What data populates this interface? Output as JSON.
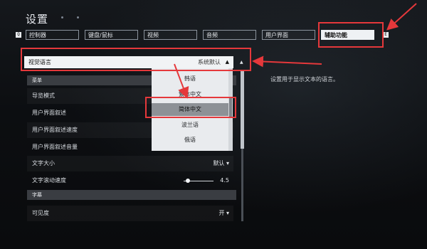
{
  "header": {
    "title": "设置"
  },
  "tabs": {
    "left_key": "Q",
    "right_key": "E",
    "items": [
      {
        "label": "控制器"
      },
      {
        "label": "键盘/鼠标"
      },
      {
        "label": "视频"
      },
      {
        "label": "音频"
      },
      {
        "label": "用户界面"
      },
      {
        "label": "辅助功能",
        "active": true
      }
    ]
  },
  "language_setting": {
    "label": "视觉语言",
    "value": "系统默认",
    "description": "设置用于显示文本的语言。"
  },
  "dropdown": {
    "options": [
      {
        "label": "韩语"
      },
      {
        "label": "繁体中文"
      },
      {
        "label": "简体中文",
        "selected": true
      },
      {
        "label": "波兰语"
      },
      {
        "label": "俄语"
      }
    ]
  },
  "sections": {
    "menu": "菜单",
    "subtitles": "字幕"
  },
  "rows": {
    "nav_mode": {
      "label": "导览模式"
    },
    "ui_narration": {
      "label": "用户界面叙述"
    },
    "ui_narration_speed": {
      "label": "用户界面叙述速度"
    },
    "ui_narration_volume": {
      "label": "用户界面叙述音量"
    },
    "text_size": {
      "label": "文字大小",
      "value": "默认"
    },
    "text_scroll_speed": {
      "label": "文字滚动速度",
      "value": "4.5"
    },
    "visibility": {
      "label": "可见度",
      "value": "开"
    }
  },
  "text_scroll_speed_level": 0.15,
  "colors": {
    "annotation": "#e5383b",
    "active_tab": "#eef1f4"
  }
}
